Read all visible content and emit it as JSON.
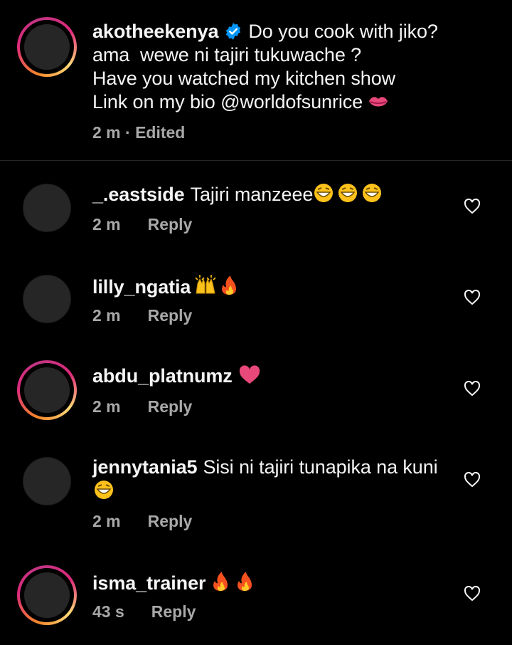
{
  "caption": {
    "username": "akotheekenya",
    "line1": "Do you cook with jiko?",
    "line2": "ama  wewe ni tajiri tukuwache ?",
    "line3": "Have you watched my kitchen show",
    "line4": "Link on my bio @worldofsunrice",
    "meta": "2 m · Edited"
  },
  "comments": [
    {
      "username": "_.eastside",
      "text": "Tajiri manzeee",
      "emoji": "grin-sweat x3",
      "time": "2 m",
      "reply": "Reply"
    },
    {
      "username": "lilly_ngatia",
      "text": "",
      "emoji": "raised-hands, fire",
      "time": "2 m",
      "reply": "Reply"
    },
    {
      "username": "abdu_platnumz",
      "text": "",
      "emoji": "heart",
      "time": "2 m",
      "reply": "Reply"
    },
    {
      "username": "jennytania5",
      "text": "Sisi ni tajiri tunapika na kuni",
      "emoji": "grin-sweat",
      "time": "2 m",
      "reply": "Reply"
    },
    {
      "username": "isma_trainer",
      "text": "",
      "emoji": "fire x2",
      "time": "43 s",
      "reply": "Reply"
    }
  ],
  "colors": {
    "verified": "#0095f6",
    "secondary_text": "#a8a8a8",
    "heart_emoji": "#e8487a"
  }
}
